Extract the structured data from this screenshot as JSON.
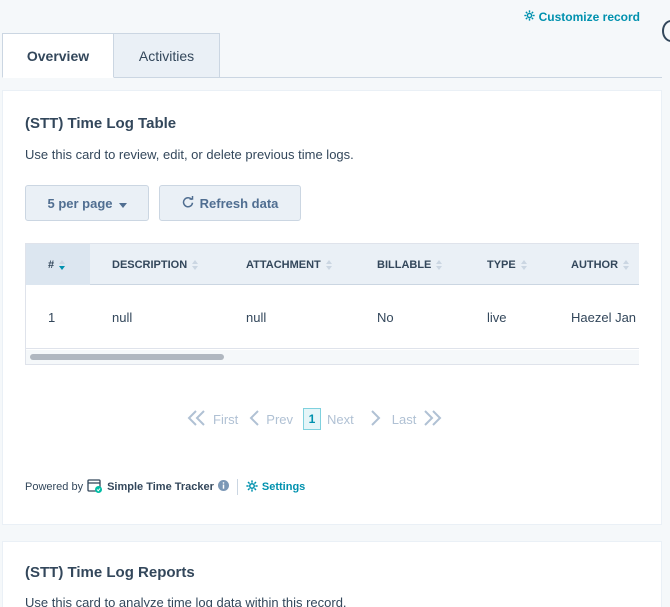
{
  "header": {
    "customize_label": "Customize record"
  },
  "tabs": [
    {
      "label": "Overview"
    },
    {
      "label": "Activities"
    }
  ],
  "time_log_card": {
    "title": "(STT) Time Log Table",
    "description": "Use this card to review, edit, or delete previous time logs.",
    "per_page_label": "5 per page",
    "refresh_label": "Refresh data",
    "table": {
      "columns": [
        "#",
        "DESCRIPTION",
        "ATTACHMENT",
        "BILLABLE",
        "TYPE",
        "AUTHOR"
      ],
      "rows": [
        [
          "1",
          "null",
          "null",
          "No",
          "live",
          "Haezel Jan"
        ]
      ]
    },
    "pagination": {
      "first_label": "First",
      "prev_label": "Prev",
      "current_page": "1",
      "next_label": "Next",
      "last_label": "Last"
    },
    "footer": {
      "powered_by": "Powered by",
      "brand": "Simple Time Tracker",
      "settings_label": "Settings"
    }
  },
  "reports_card": {
    "title": "(STT) Time Log Reports",
    "description": "Use this card to analyze time log data within this record."
  },
  "colors": {
    "accent": "#0091ae",
    "text": "#33475b",
    "border": "#cbd6e2",
    "header_bg": "#eaf0f6"
  }
}
